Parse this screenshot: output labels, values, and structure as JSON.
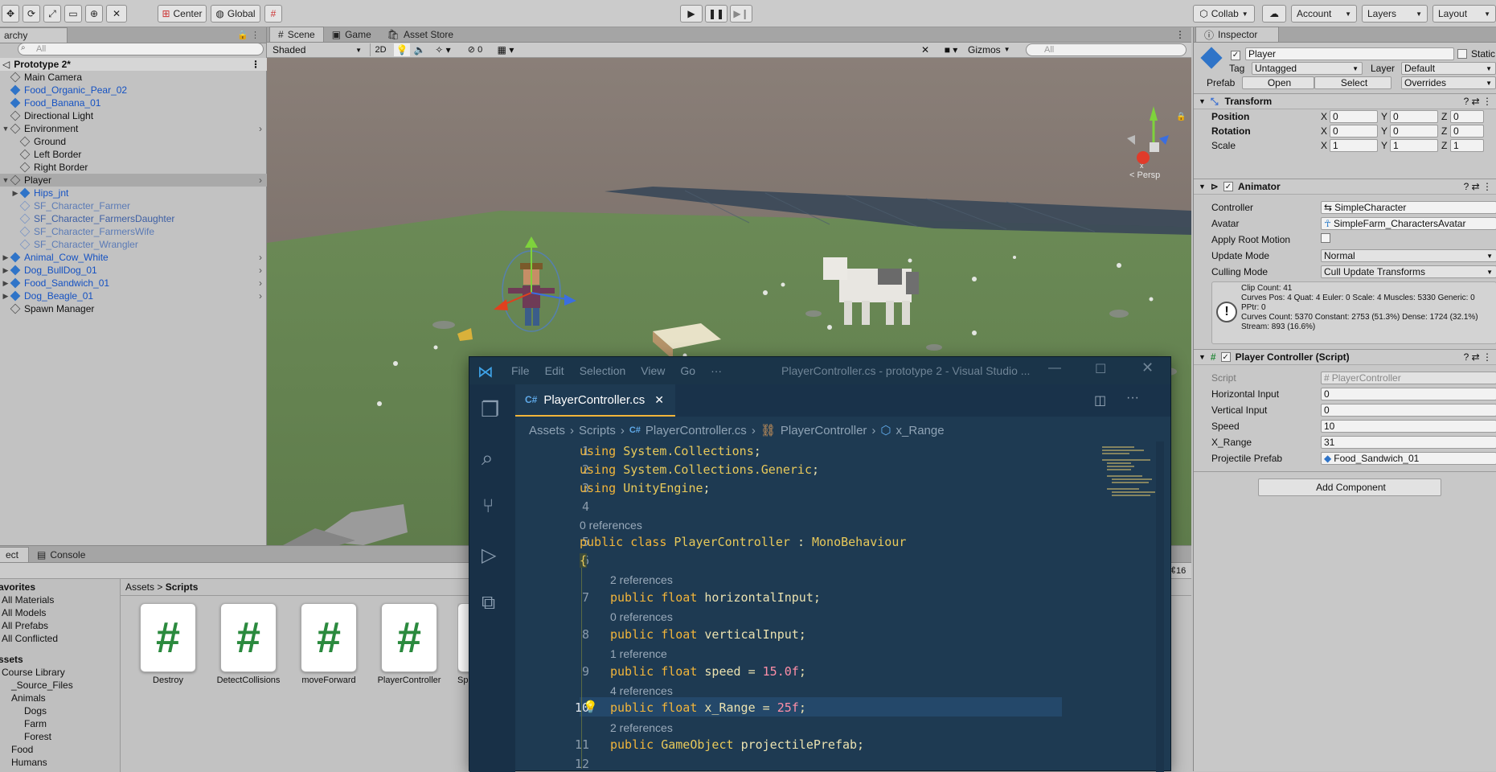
{
  "toolbar": {
    "center": "Center",
    "global": "Global",
    "collab": "Collab",
    "account": "Account",
    "layers": "Layers",
    "layout": "Layout"
  },
  "hierarchy": {
    "tab": "archy",
    "search_placeholder": "All",
    "scene": "Prototype 2*",
    "items": [
      {
        "label": "Main Camera",
        "indent": 1,
        "style": "normal",
        "arrow": ""
      },
      {
        "label": "Food_Organic_Pear_02",
        "indent": 1,
        "style": "blue",
        "arrow": ""
      },
      {
        "label": "Food_Banana_01",
        "indent": 1,
        "style": "blue",
        "arrow": ""
      },
      {
        "label": "Directional Light",
        "indent": 1,
        "style": "normal",
        "arrow": ""
      },
      {
        "label": "Environment",
        "indent": 1,
        "style": "normal",
        "arrow": "▼"
      },
      {
        "label": "Ground",
        "indent": 2,
        "style": "normal",
        "arrow": ""
      },
      {
        "label": "Left Border",
        "indent": 2,
        "style": "normal",
        "arrow": ""
      },
      {
        "label": "Right Border",
        "indent": 2,
        "style": "normal",
        "arrow": ""
      },
      {
        "label": "Player",
        "indent": 1,
        "style": "normal",
        "arrow": "▼"
      },
      {
        "label": "Hips_jnt",
        "indent": 2,
        "style": "blue",
        "arrow": "▶"
      },
      {
        "label": "SF_Character_Farmer",
        "indent": 2,
        "style": "faded",
        "arrow": ""
      },
      {
        "label": "SF_Character_FarmersDaughter",
        "indent": 2,
        "style": "faded2",
        "arrow": ""
      },
      {
        "label": "SF_Character_FarmersWife",
        "indent": 2,
        "style": "faded",
        "arrow": ""
      },
      {
        "label": "SF_Character_Wrangler",
        "indent": 2,
        "style": "faded",
        "arrow": ""
      },
      {
        "label": "Animal_Cow_White",
        "indent": 1,
        "style": "blue",
        "arrow": "▶"
      },
      {
        "label": "Dog_BullDog_01",
        "indent": 1,
        "style": "blue",
        "arrow": "▶"
      },
      {
        "label": "Food_Sandwich_01",
        "indent": 1,
        "style": "blue",
        "arrow": "▶"
      },
      {
        "label": "Dog_Beagle_01",
        "indent": 1,
        "style": "blue",
        "arrow": "▶"
      },
      {
        "label": "Spawn Manager",
        "indent": 1,
        "style": "normal",
        "arrow": ""
      }
    ]
  },
  "scene": {
    "tabs": [
      "Scene",
      "Game",
      "Asset Store"
    ],
    "shading": "Shaded",
    "mode_2d": "2D",
    "hidden_count": "0",
    "gizmos": "Gizmos",
    "search_placeholder": "All",
    "persp": "Persp"
  },
  "project": {
    "tabs": [
      "ect",
      "Console"
    ],
    "favorites_header": "avorites",
    "favorites": [
      "All Materials",
      "All Models",
      "All Prefabs",
      "All Conflicted"
    ],
    "assets_header": "ssets",
    "tree": [
      "Course Library",
      "_Source_Files",
      "Animals",
      "Dogs",
      "Farm",
      "Forest",
      "Food",
      "Humans"
    ],
    "breadcrumb": [
      "Assets",
      "Scripts"
    ],
    "assets": [
      "Destroy",
      "DetectCollisions",
      "moveForward",
      "PlayerController",
      "Sp"
    ],
    "count": "16"
  },
  "inspector": {
    "tab": "Inspector",
    "name": "Player",
    "static_label": "Static",
    "tag_label": "Tag",
    "tag_value": "Untagged",
    "layer_label": "Layer",
    "layer_value": "Default",
    "prefab_label": "Prefab",
    "open": "Open",
    "select": "Select",
    "overrides": "Overrides",
    "transform": {
      "title": "Transform",
      "rows": [
        {
          "label": "Position",
          "x": "0",
          "y": "0",
          "z": "0"
        },
        {
          "label": "Rotation",
          "x": "0",
          "y": "0",
          "z": "0"
        },
        {
          "label": "Scale",
          "x": "1",
          "y": "1",
          "z": "1"
        }
      ]
    },
    "animator": {
      "title": "Animator",
      "controller_label": "Controller",
      "controller": "SimpleCharacter",
      "avatar_label": "Avatar",
      "avatar": "SimpleFarm_CharactersAvatar",
      "root_motion_label": "Apply Root Motion",
      "update_mode_label": "Update Mode",
      "update_mode": "Normal",
      "culling_label": "Culling Mode",
      "culling": "Cull Update Transforms",
      "info": [
        "Clip Count: 41",
        "Curves Pos: 4 Quat: 4 Euler: 0 Scale: 4 Muscles: 5330 Generic: 0",
        "PPtr: 0",
        "Curves Count: 5370 Constant: 2753 (51.3%) Dense: 1724 (32.1%)",
        "Stream: 893 (16.6%)"
      ]
    },
    "script": {
      "title": "Player Controller (Script)",
      "script_label": "Script",
      "script_value": "PlayerController",
      "horizontal_label": "Horizontal Input",
      "horizontal": "0",
      "vertical_label": "Vertical Input",
      "vertical": "0",
      "speed_label": "Speed",
      "speed": "10",
      "xrange_label": "X_Range",
      "xrange": "31",
      "projectile_label": "Projectile Prefab",
      "projectile": "Food_Sandwich_01"
    },
    "add_component": "Add Component"
  },
  "vscode": {
    "menu": [
      "File",
      "Edit",
      "Selection",
      "View",
      "Go",
      "···"
    ],
    "title": "PlayerController.cs - prototype 2 - Visual Studio ...",
    "tab_prefix": "C#",
    "tab": "PlayerController.cs",
    "breadcrumb": [
      "Assets",
      "Scripts",
      "PlayerController.cs",
      "PlayerController",
      "x_Range"
    ],
    "lines": [
      "1",
      "2",
      "3",
      "4",
      "5",
      "6",
      "7",
      "8",
      "9",
      "10",
      "11",
      "12"
    ],
    "refs": [
      "0 references",
      "2 references",
      "0 references",
      "1 reference",
      "4 references",
      "2 references"
    ]
  },
  "colors": {
    "vscode_bg": "#1e3a52",
    "vscode_sidebar": "#183047",
    "accent_blue": "#1552c2",
    "ground": "#6d8f55"
  }
}
